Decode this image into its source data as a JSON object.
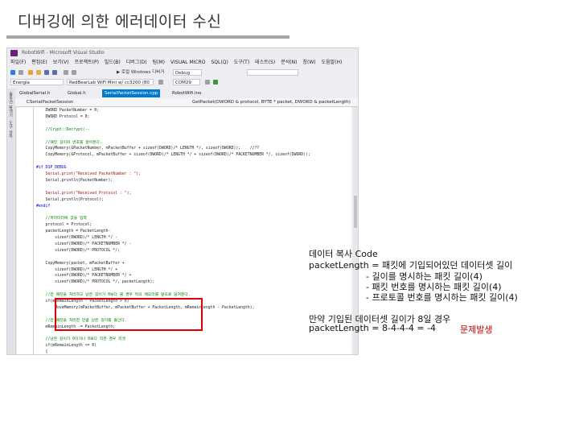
{
  "slide": {
    "title": "디버깅에 의한 에러데이터 수신"
  },
  "vs": {
    "window_title": "RobotWifi - Microsoft Visual Studio",
    "menu": [
      "파일(F)",
      "편집(E)",
      "보기(V)",
      "프로젝트(P)",
      "빌드(B)",
      "디버그(D)",
      "팀(M)",
      "VISUAL MICRO",
      "SQL(Q)",
      "도구(T)",
      "테스트(S)",
      "분석(N)",
      "창(W)",
      "도움말(H)"
    ],
    "toolbar": {
      "windows_debugger": "▶ 로컬 Windows 디버거",
      "config": "Debug"
    },
    "toolbar2": {
      "platform": "Energia",
      "board": "RedBearLab WiFi Mini w/ cc3200 (80",
      "port": "COM29"
    },
    "sidebar": [
      "솔루션 탐색기",
      "도구 상자"
    ],
    "tabs": [
      "GlobalSerial.h",
      "Global.h",
      "SerialPacketSession.cpp",
      "RobotWifi.ino"
    ],
    "nav_left": "CSerialPacketSession",
    "nav_right": "GetPacket(DWORD & protocol, BYTE * packet, DWORD & packetLength)",
    "code": [
      {
        "text": "    DWORD PacketNumber = 0;",
        "kind": "normal"
      },
      {
        "text": "    DWORD Protocol = 0;",
        "kind": "normal"
      },
      {
        "text": "",
        "kind": "normal"
      },
      {
        "text": "    //Crypt::Decrypt(--",
        "kind": "comment"
      },
      {
        "text": "",
        "kind": "normal"
      },
      {
        "text": "    //패킷 길이와 번호를 알아온다.",
        "kind": "comment"
      },
      {
        "text": "    CopyMemory(&PacketNumber, mPacketBuffer + sizeof(DWORD)/* LENGTH */, sizeof(DWORD));    //??",
        "kind": "normal"
      },
      {
        "text": "    CopyMemory(&Protocol, mPacketBuffer + sizeof(DWORD)/* LENGTH */ + sizeof(DWORD)/* PACKETNUMBER */, sizeof(DWORD));",
        "kind": "normal"
      },
      {
        "text": "",
        "kind": "normal"
      },
      {
        "text": "#if DSP_DEBUG",
        "kind": "pre"
      },
      {
        "text": "    Serial.print(\"Received PacketNumber : \");",
        "kind": "string"
      },
      {
        "text": "    Serial.println(PacketNumber);",
        "kind": "normal"
      },
      {
        "text": "",
        "kind": "normal"
      },
      {
        "text": "    Serial.print(\"Received Protocol : \");",
        "kind": "string"
      },
      {
        "text": "    Serial.println(Protocol);",
        "kind": "normal"
      },
      {
        "text": "#endif",
        "kind": "pre"
      },
      {
        "text": "",
        "kind": "normal"
      },
      {
        "text": "    //파라미터에 값을 입력",
        "kind": "comment"
      },
      {
        "text": "    protocol = Protocol;",
        "kind": "normal"
      },
      {
        "text": "    packetLength = PacketLength-",
        "kind": "normal"
      },
      {
        "text": "        sizeof(DWORD)/* LENGTH */ -",
        "kind": "normal"
      },
      {
        "text": "        sizeof(DWORD)/* PACKETNUMBER */ -",
        "kind": "normal"
      },
      {
        "text": "        sizeof(DWORD)/* PROTOCOL */;",
        "kind": "normal"
      },
      {
        "text": "",
        "kind": "normal"
      },
      {
        "text": "    CopyMemory(packet, mPacketBuffer +",
        "kind": "normal"
      },
      {
        "text": "        sizeof(DWORD)/* LENGTH */ +",
        "kind": "normal"
      },
      {
        "text": "        sizeof(DWORD)/* PACKETNUMBER */ +",
        "kind": "normal"
      },
      {
        "text": "        sizeof(DWORD)/* PROTOCOL */, packetLength);",
        "kind": "normal"
      },
      {
        "text": "",
        "kind": "normal"
      },
      {
        "text": "    //한 패킷을 처리하고 남은 길이가 0보다 클 경우 뒤의 메모리를 앞으로 당겨준다.",
        "kind": "comment"
      },
      {
        "text": "    if(mRemainLength - PacketLength > 0)",
        "kind": "normal"
      },
      {
        "text": "        MoveMemory(mPacketBuffer, mPacketBuffer + PacketLength, mRemainLength - PacketLength);",
        "kind": "normal"
      },
      {
        "text": "",
        "kind": "normal"
      },
      {
        "text": "    //한 패킷을 처리한 만큼 남은 길이를 줄인다.",
        "kind": "comment"
      },
      {
        "text": "    mRemainLength -= PacketLength;",
        "kind": "normal"
      },
      {
        "text": "",
        "kind": "normal"
      },
      {
        "text": "    //남은 길이가 0이거나 0보다 작은 경우 리셋",
        "kind": "comment"
      },
      {
        "text": "    if(mRemainLength <= 0)",
        "kind": "normal"
      },
      {
        "text": "    {",
        "kind": "normal"
      }
    ]
  },
  "notes": {
    "line1": "데이터 복사 Code",
    "line2": "packetLength = 패킷에 기입되어있던 데이터셋 길이",
    "line3": "- 길이를 명시하는 패킷 길이(4)",
    "line4": "- 패킷 번호를 명시하는 패킷 길이(4)",
    "line5": "- 프로토콜 번호를 명시하는 패킷 길이(4)",
    "line6": "만약 기입된 데이터셋 길이가 8일 경우",
    "line7": "packetLength = 8-4-4-4 = -4",
    "problem": "문제발생"
  },
  "colors": {
    "highlight_box": "#e00000",
    "active_tab": "#007acc",
    "problem_text": "#c00000"
  }
}
